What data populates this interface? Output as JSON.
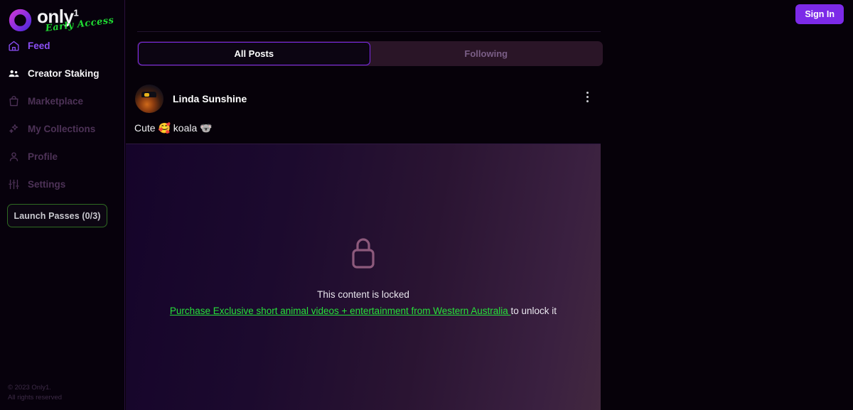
{
  "brand": {
    "name": "only",
    "superscript": "1",
    "tagline": "Early Access",
    "logo_icon": "ring-logo-icon",
    "ring_color_start": "#a233d8",
    "ring_color_end": "#5b2fd6",
    "tagline_color": "#1fd832"
  },
  "sidebar": {
    "items": [
      {
        "label": "Feed",
        "icon": "home-icon",
        "state": "active"
      },
      {
        "label": "Creator Staking",
        "icon": "people-group-icon",
        "state": "bright"
      },
      {
        "label": "Marketplace",
        "icon": "shopping-bag-icon",
        "state": "dim"
      },
      {
        "label": "My Collections",
        "icon": "sparkles-icon",
        "state": "dim"
      },
      {
        "label": "Profile",
        "icon": "user-icon",
        "state": "dim"
      },
      {
        "label": "Settings",
        "icon": "sliders-icon",
        "state": "dim"
      }
    ],
    "launch_passes": {
      "label": "Launch Passes (0/3)",
      "border_color": "#2f6b22"
    },
    "footer_line1": "© 2023 Only1.",
    "footer_line2": "All rights reserved"
  },
  "header": {
    "sign_in_label": "Sign In",
    "sign_in_color": "#7c2ae8"
  },
  "tabs": {
    "items": [
      {
        "label": "All Posts",
        "active": true
      },
      {
        "label": "Following",
        "active": false
      }
    ],
    "active_border_color": "#7c2ae8"
  },
  "post": {
    "author": "Linda Sunshine",
    "avatar_icon": "user-avatar-photo",
    "menu_icon": "kebab-menu-icon",
    "caption": "Cute 🥰 koala 🐨",
    "locked": {
      "lock_icon": "padlock-icon",
      "title": "This content is locked",
      "link_text": "Purchase Exclusive short animal videos + entertainment from Western Australia ",
      "suffix_text": "to unlock it",
      "link_color": "#27e03a"
    }
  }
}
